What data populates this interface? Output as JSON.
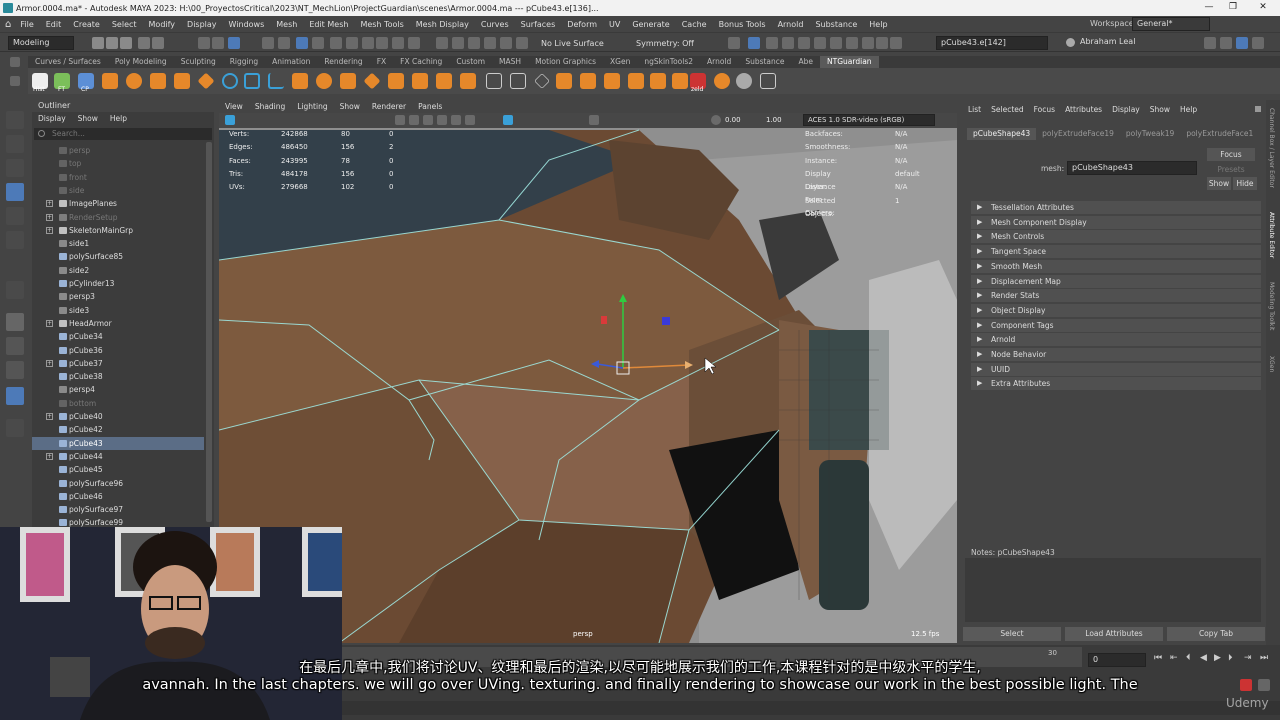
{
  "window": {
    "title": "Armor.0004.ma* - Autodesk MAYA 2023: H:\\00_ProyectosCritical\\2023\\NT_MechLion\\ProjectGuardian\\scenes\\Armor.0004.ma  ---  pCube43.e[136]..."
  },
  "menubar": [
    "File",
    "Edit",
    "Create",
    "Select",
    "Modify",
    "Display",
    "Windows",
    "Mesh",
    "Edit Mesh",
    "Mesh Tools",
    "Mesh Display",
    "Curves",
    "Surfaces",
    "Deform",
    "UV",
    "Generate",
    "Cache",
    "Bonus Tools",
    "Arnold",
    "Substance",
    "Help"
  ],
  "workspace": {
    "label": "Workspace:",
    "value": "General*"
  },
  "statusline": {
    "mode": "Modeling",
    "live_surface": "No Live Surface",
    "symmetry": "Symmetry: Off",
    "selection_field": "pCube43.e[142]",
    "user": "Abraham Leal"
  },
  "shelf_tabs": [
    "Curves / Surfaces",
    "Poly Modeling",
    "Sculpting",
    "Rigging",
    "Animation",
    "Rendering",
    "FX",
    "FX Caching",
    "Custom",
    "MASH",
    "Motion Graphics",
    "XGen",
    "ngSkinTools2",
    "Arnold",
    "Substance",
    "Abe",
    "NTGuardian"
  ],
  "shelf_active": "NTGuardian",
  "shelf_labels": [
    "Hist",
    "FT",
    "CP",
    "zeld"
  ],
  "outliner": {
    "title": "Outliner",
    "menu": [
      "Display",
      "Show",
      "Help"
    ],
    "search_placeholder": "Search...",
    "items": [
      {
        "label": "persp",
        "dim": true,
        "expand": false,
        "icon": "camera"
      },
      {
        "label": "top",
        "dim": true,
        "expand": false,
        "icon": "camera"
      },
      {
        "label": "front",
        "dim": true,
        "expand": false,
        "icon": "camera"
      },
      {
        "label": "side",
        "dim": true,
        "expand": false,
        "icon": "camera"
      },
      {
        "label": "ImagePlanes",
        "dim": false,
        "expand": true,
        "icon": "group"
      },
      {
        "label": "RenderSetup",
        "dim": true,
        "expand": true,
        "icon": "group"
      },
      {
        "label": "SkeletonMainGrp",
        "dim": false,
        "expand": true,
        "icon": "group"
      },
      {
        "label": "side1",
        "dim": false,
        "expand": false,
        "icon": "camera"
      },
      {
        "label": "polySurface85",
        "dim": false,
        "expand": false,
        "icon": "mesh"
      },
      {
        "label": "side2",
        "dim": false,
        "expand": false,
        "icon": "camera"
      },
      {
        "label": "pCylinder13",
        "dim": false,
        "expand": false,
        "icon": "mesh"
      },
      {
        "label": "persp3",
        "dim": false,
        "expand": false,
        "icon": "camera"
      },
      {
        "label": "side3",
        "dim": false,
        "expand": false,
        "icon": "camera"
      },
      {
        "label": "HeadArmor",
        "dim": false,
        "expand": true,
        "icon": "group"
      },
      {
        "label": "pCube34",
        "dim": false,
        "expand": false,
        "icon": "mesh"
      },
      {
        "label": "pCube36",
        "dim": false,
        "expand": false,
        "icon": "mesh"
      },
      {
        "label": "pCube37",
        "dim": false,
        "expand": true,
        "icon": "mesh"
      },
      {
        "label": "pCube38",
        "dim": false,
        "expand": false,
        "icon": "mesh"
      },
      {
        "label": "persp4",
        "dim": false,
        "expand": false,
        "icon": "camera"
      },
      {
        "label": "bottom",
        "dim": true,
        "expand": false,
        "icon": "camera"
      },
      {
        "label": "pCube40",
        "dim": false,
        "expand": true,
        "icon": "mesh"
      },
      {
        "label": "pCube42",
        "dim": false,
        "expand": false,
        "icon": "mesh"
      },
      {
        "label": "pCube43",
        "dim": false,
        "expand": false,
        "icon": "mesh",
        "selected": true
      },
      {
        "label": "pCube44",
        "dim": false,
        "expand": true,
        "icon": "mesh"
      },
      {
        "label": "pCube45",
        "dim": false,
        "expand": false,
        "icon": "mesh"
      },
      {
        "label": "polySurface96",
        "dim": false,
        "expand": false,
        "icon": "mesh"
      },
      {
        "label": "pCube46",
        "dim": false,
        "expand": false,
        "icon": "mesh"
      },
      {
        "label": "polySurface97",
        "dim": false,
        "expand": false,
        "icon": "mesh"
      },
      {
        "label": "polySurface99",
        "dim": false,
        "expand": false,
        "icon": "mesh"
      }
    ]
  },
  "viewport": {
    "menu": [
      "View",
      "Shading",
      "Lighting",
      "Show",
      "Renderer",
      "Panels"
    ],
    "exposure": "0.00",
    "gamma": "1.00",
    "colorspace": "ACES 1.0 SDR-video (sRGB)",
    "hud_left": [
      {
        "label": "Verts:",
        "a": "242868",
        "b": "80",
        "c": "0"
      },
      {
        "label": "Edges:",
        "a": "486450",
        "b": "156",
        "c": "2"
      },
      {
        "label": "Faces:",
        "a": "243995",
        "b": "78",
        "c": "0"
      },
      {
        "label": "Tris:",
        "a": "484178",
        "b": "156",
        "c": "0"
      },
      {
        "label": "UVs:",
        "a": "279668",
        "b": "102",
        "c": "0"
      }
    ],
    "hud_right": [
      {
        "label": "Backfaces:",
        "value": "N/A"
      },
      {
        "label": "Smoothness:",
        "value": "N/A"
      },
      {
        "label": "Instance:",
        "value": "N/A"
      },
      {
        "label": "Display Layer:",
        "value": "default"
      },
      {
        "label": "Distance From Camera:",
        "value": "N/A"
      },
      {
        "label": "Selected Objects:",
        "value": "1"
      }
    ],
    "camera": "persp",
    "fps": "12.5 fps"
  },
  "attribute_editor": {
    "menu": [
      "List",
      "Selected",
      "Focus",
      "Attributes",
      "Display",
      "Show",
      "Help"
    ],
    "tabs": [
      "pCubeShape43",
      "polyExtrudeFace19",
      "polyTweak19",
      "polyExtrudeFace1"
    ],
    "mesh_label": "mesh:",
    "mesh_value": "pCubeShape43",
    "focus": "Focus",
    "presets": "Presets",
    "show": "Show",
    "hide": "Hide",
    "sections": [
      "Tessellation Attributes",
      "Mesh Component Display",
      "Mesh Controls",
      "Tangent Space",
      "Smooth Mesh",
      "Displacement Map",
      "Render Stats",
      "Object Display",
      "Component Tags",
      "Arnold",
      "Node Behavior",
      "UUID",
      "Extra Attributes"
    ],
    "notes": "Notes: pCubeShape43",
    "buttons": [
      "Select",
      "Load Attributes",
      "Copy Tab"
    ]
  },
  "side_tabs": [
    "Channel Box / Layer Editor",
    "Attribute Editor",
    "Modeling Toolkit",
    "XGen"
  ],
  "timeline": {
    "end": "30",
    "current": "0"
  },
  "subtitles": {
    "zh": "在最后几章中,我们将讨论UV、纹理和最后的渲染,以尽可能地展示我们的工作,本课程针对的是中级水平的学生,",
    "en": "avannah. In the last chapters. we will go over UVing. texturing. and finally rendering to showcase our work in the best possible light. The"
  },
  "watermark": "Udemy",
  "colors": {
    "accent": "#5b6d86",
    "mesh_brown": "#7a5a3e",
    "wire_cyan": "#9fe6e0"
  }
}
